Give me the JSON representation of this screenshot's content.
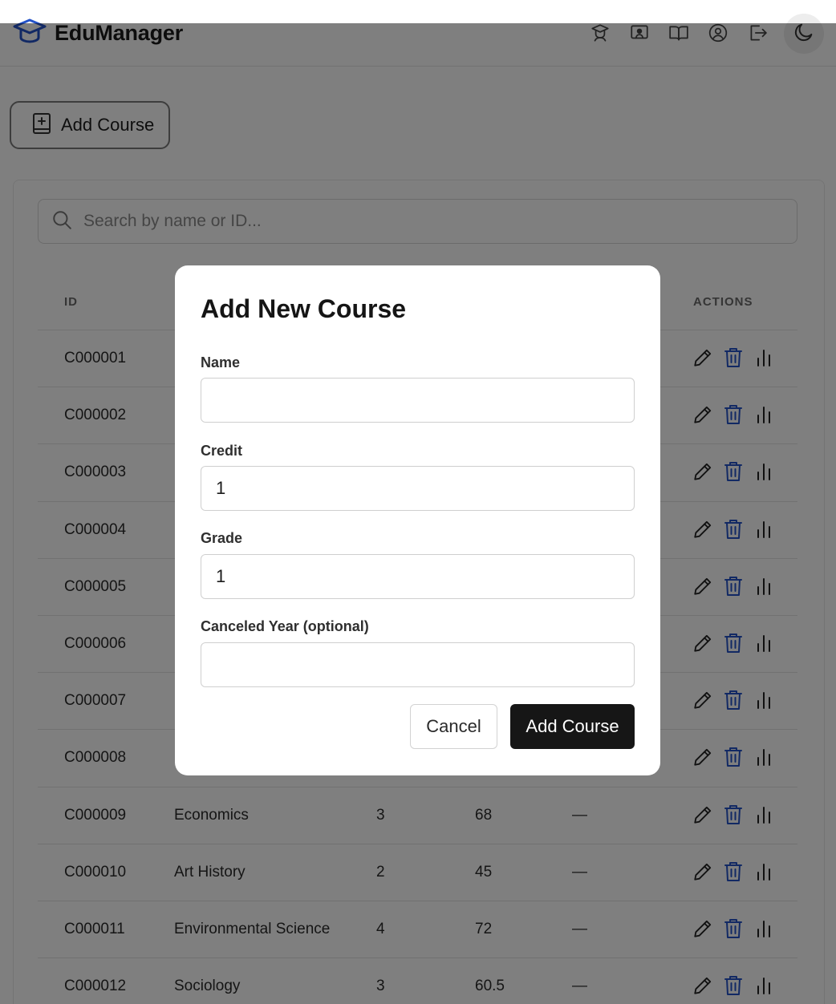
{
  "app": {
    "brand": "EduManager",
    "accent": "#2453c9"
  },
  "nav": {
    "icons": [
      "student-icon",
      "classroom-icon",
      "book-icon",
      "profile-icon",
      "logout-icon"
    ],
    "theme_icon": "moon-icon"
  },
  "toolbar": {
    "add_course_label": "Add Course"
  },
  "search": {
    "placeholder": "Search by name or ID..."
  },
  "table": {
    "headers": {
      "id": "ID",
      "actions": "ACTIONS"
    },
    "rows": [
      {
        "id": "C000001",
        "name": "",
        "credit": "",
        "grade": "",
        "canceled": ""
      },
      {
        "id": "C000002",
        "name": "",
        "credit": "",
        "grade": "",
        "canceled": ""
      },
      {
        "id": "C000003",
        "name": "",
        "credit": "",
        "grade": "",
        "canceled": ""
      },
      {
        "id": "C000004",
        "name": "",
        "credit": "",
        "grade": "",
        "canceled": ""
      },
      {
        "id": "C000005",
        "name": "",
        "credit": "",
        "grade": "",
        "canceled": ""
      },
      {
        "id": "C000006",
        "name": "",
        "credit": "",
        "grade": "",
        "canceled": ""
      },
      {
        "id": "C000007",
        "name": "",
        "credit": "",
        "grade": "",
        "canceled": ""
      },
      {
        "id": "C000008",
        "name": "",
        "credit": "",
        "grade": "",
        "canceled": ""
      },
      {
        "id": "C000009",
        "name": "Economics",
        "credit": "3",
        "grade": "68",
        "canceled": "—"
      },
      {
        "id": "C000010",
        "name": "Art History",
        "credit": "2",
        "grade": "45",
        "canceled": "—"
      },
      {
        "id": "C000011",
        "name": "Environmental Science",
        "credit": "4",
        "grade": "72",
        "canceled": "—"
      },
      {
        "id": "C000012",
        "name": "Sociology",
        "credit": "3",
        "grade": "60.5",
        "canceled": "—"
      }
    ]
  },
  "modal": {
    "title": "Add New Course",
    "fields": {
      "name": {
        "label": "Name",
        "value": ""
      },
      "credit": {
        "label": "Credit",
        "value": "1"
      },
      "grade": {
        "label": "Grade",
        "value": "1"
      },
      "canceled_year": {
        "label": "Canceled Year (optional)",
        "value": ""
      }
    },
    "cancel_label": "Cancel",
    "submit_label": "Add Course"
  }
}
